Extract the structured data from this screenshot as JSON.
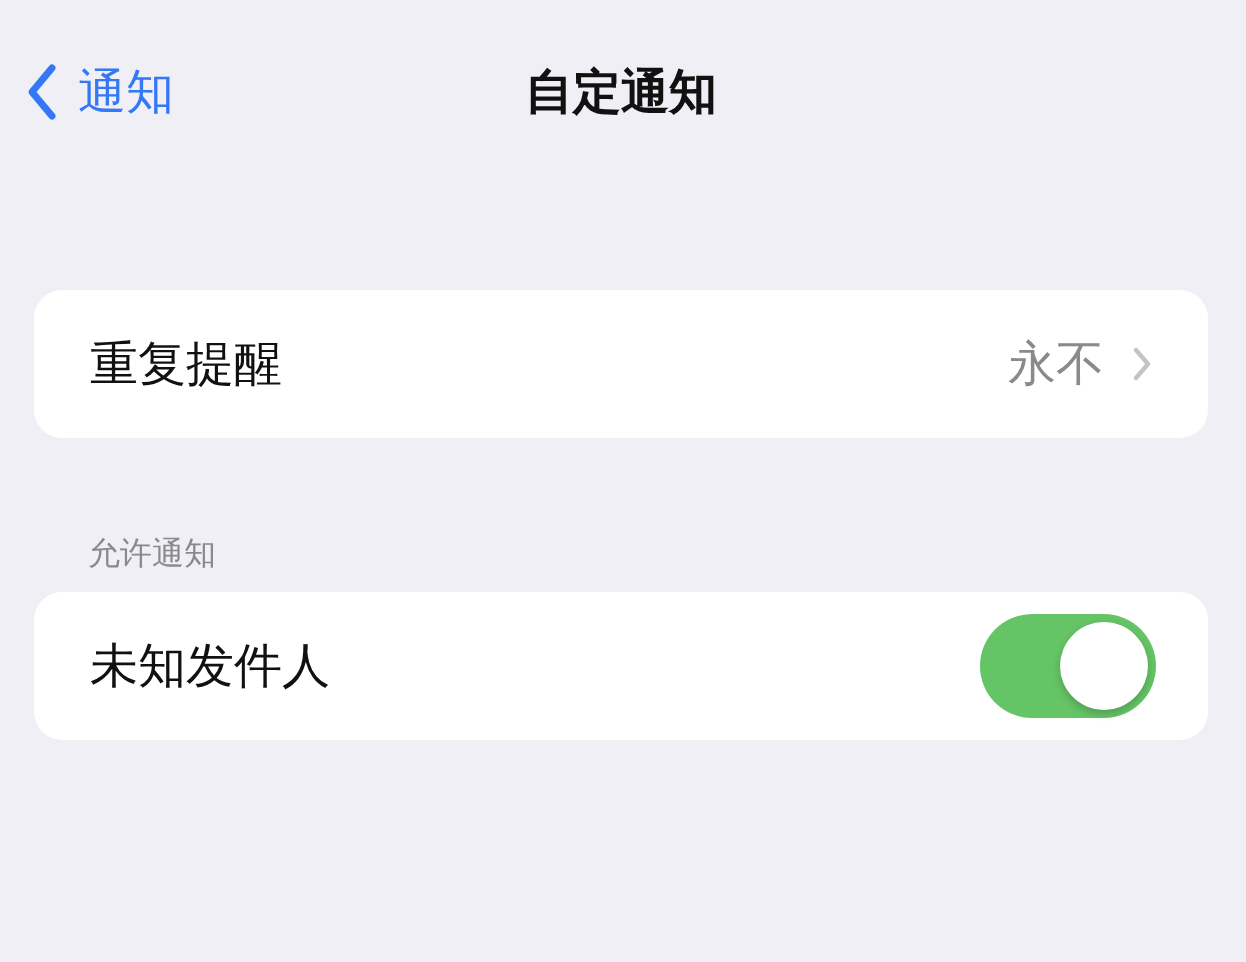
{
  "nav": {
    "back": "通知",
    "title": "自定通知"
  },
  "sections": [
    {
      "items": [
        {
          "kind": "link",
          "label": "重复提醒",
          "value": "永不"
        }
      ]
    },
    {
      "header": "允许通知",
      "items": [
        {
          "kind": "toggle",
          "label": "未知发件人",
          "on": true
        }
      ]
    }
  ]
}
